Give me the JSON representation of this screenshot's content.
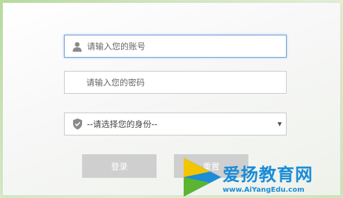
{
  "form": {
    "account_placeholder": "请输入您的账号",
    "password_placeholder": "请输入您的密码",
    "role_select_value": "--请选择您的身份--"
  },
  "buttons": {
    "login_label": "登录",
    "reset_label": "重置"
  },
  "watermark": {
    "text": "爱扬教育网",
    "url": "www.AiYangEdu.com"
  },
  "icons": {
    "account": "user-icon",
    "role": "shield-icon",
    "select_arrow": "caret-down-icon"
  },
  "colors": {
    "focus_border": "#6aa0d8",
    "button_bg": "#cfcfcf",
    "watermark": "#1a8cd8"
  }
}
